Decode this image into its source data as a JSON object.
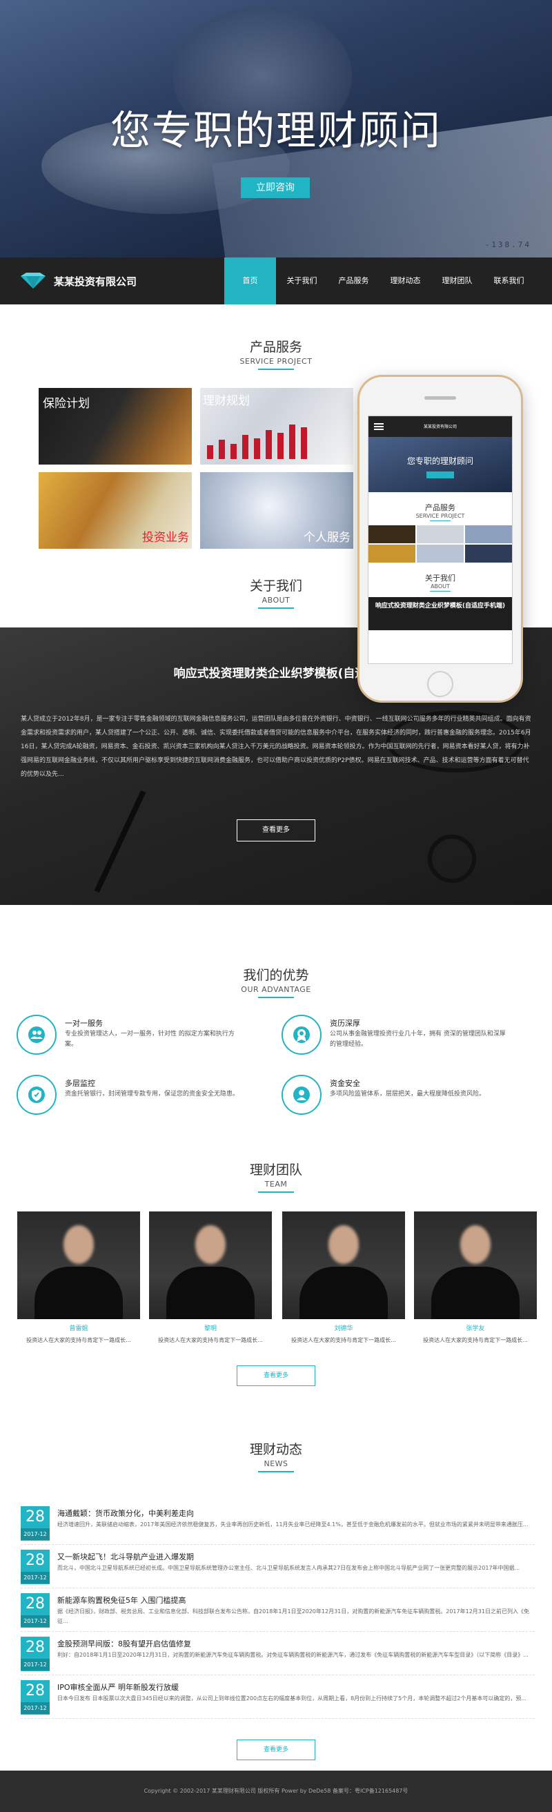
{
  "hero": {
    "title": "您专职的理财顾问",
    "button": "立即咨询",
    "numbers": "-138.74"
  },
  "nav": {
    "logo_text": "某某投资有限公司",
    "items": [
      "首页",
      "关于我们",
      "产品服务",
      "理财动态",
      "理财团队",
      "联系我们"
    ]
  },
  "products": {
    "title_cn": "产品服务",
    "title_en": "SERVICE PROJECT",
    "items": [
      "保险计划",
      "理财规划",
      "投资业务",
      "个人服务"
    ]
  },
  "phone": {
    "logo": "某某投资有限公司",
    "hero_title": "您专职的理财顾问",
    "services_cn": "产品服务",
    "services_en": "SERVICE PROJECT",
    "about_cn": "关于我们",
    "about_en": "ABOUT",
    "dark_title": "响应式投资理财类企业织梦模板(自适应手机端)"
  },
  "about": {
    "title_cn": "关于我们",
    "title_en": "ABOUT",
    "headline": "响应式投资理财类企业织梦模板(自适应",
    "text": "某人贷成立于2012年8月，是一家专注于零售金融领域的互联网金融信息服务公司，运营团队是由多位曾在外资银行、中资银行、一线互联网公司服务多年的行业精英共同组成。面向有资金需求和投资需求的用户，某人贷搭建了一个公正、公开、透明、诚信、实现委托借款或者借贷可能的信息服务中介平台，在服务实体经济的同时，践行普惠金融的服务理念。2015年6月16日，某人贷完成A轮融资，网易资本、金石投资、凯兴资本三家机构向某人贷注入千万美元的战略投资。网易资本轮领投方。作为中国互联网的先行者，网易资本看好某人贷，将有力补强网易的互联网金融业务线，不仅以其所用户驱标享受到快捷的互联网消费金融服务，也可以借助户商以投资优质的P2P债权。网易在互联网技术、产品、技术和运营等方面有着无可替代的优势以及先...",
    "button": "查看更多"
  },
  "advantage": {
    "title_cn": "我们的优势",
    "title_en": "OUR ADVANTAGE",
    "items": [
      {
        "icon": "people-icon",
        "title": "一对一服务",
        "desc": "专业投资管理达人，一对一服务，针对性 的拟定方案和执行方案。"
      },
      {
        "icon": "badge-icon",
        "title": "资历深厚",
        "desc": "公司从事金融管理投资行业几十年，拥有 资深的管理团队和深厚的管理经验。"
      },
      {
        "icon": "shield-icon",
        "title": "多层监控",
        "desc": "资金托管银行，封闭管理专款专用，保证您的资金安全无隐患。"
      },
      {
        "icon": "person-icon",
        "title": "资金安全",
        "desc": "多项风险监管体系，层层把关，最大程度降低投资风险。"
      }
    ]
  },
  "team": {
    "title_cn": "理财团队",
    "title_en": "TEAM",
    "members": [
      {
        "name": "曾雷姐",
        "desc": "投资达人在大家的支持与肯定下一路成长..."
      },
      {
        "name": "黎明",
        "desc": "投资达人在大家的支持与肯定下一路成长..."
      },
      {
        "name": "刘德华",
        "desc": "投资达人在大家的支持与肯定下一路成长..."
      },
      {
        "name": "张学友",
        "desc": "投资达人在大家的支持与肯定下一路成长..."
      }
    ],
    "button": "查看更多"
  },
  "news": {
    "title_cn": "理财动态",
    "title_en": "NEWS",
    "items": [
      {
        "day": "28",
        "ym": "2017-12",
        "title": "海通戴颖：货币政策分化，中美利差走向",
        "summary": "经济增速回升，美联储启动缩表，2017年美国经济依然稳健复苏，失业率再创历史新低，11月失业率已经降至4.1%，甚至低于金融危机爆发前的水平。但就业市场的紧紧并未明显带来通胀压..."
      },
      {
        "day": "28",
        "ym": "2017-12",
        "title": "又一新块起飞！北斗导航产业进入爆发期",
        "summary": "而北斗，中国北斗卫星导航系统已经初长成。中国卫星导航系统管理办公室主任、北斗卫星导航系统发言人冉承其27日在发布会上称中国北斗导航产业网了一张更完整的展示2017年中国据..."
      },
      {
        "day": "28",
        "ym": "2017-12",
        "title": "新能源车购置税免征5年 入围门槛提高",
        "summary": "据《经济日报》，财政部、税务总局、工业和信息化部、科技部联合发布公告称，自2018年1月1日至2020年12月31日，对购置的新能源汽车免征车辆购置税。2017年12月31日之前已列入《免征..."
      },
      {
        "day": "28",
        "ym": "2017-12",
        "title": "金股预测早间版：8股有望开启估值修复",
        "summary": "利好：自2018年1月1日至2020年12月31日，对购置的新能源汽车免征车辆购置税。对免征车辆购置税的新能源汽车，通过发布《免征车辆购置税的新能源汽车车型目录》（以下简称《目录》..."
      },
      {
        "day": "28",
        "ym": "2017-12",
        "title": "IPO审核全面从严 明年新股发行放缓",
        "summary": "日本今日发布 日本股票以次大盘日345日经以来的调整，从公司上到年线位置200点左右的幅度基本到位，从周期上看，8月份到上行持续了5个月，本轮调整不超过2个月基本可以确定的，预..."
      }
    ],
    "button": "查看更多"
  },
  "footer": {
    "text": "Copyright © 2002-2017 某某理财有限公司 版权所有 Power by DeDe58 备案号：粤ICP备12165487号"
  }
}
